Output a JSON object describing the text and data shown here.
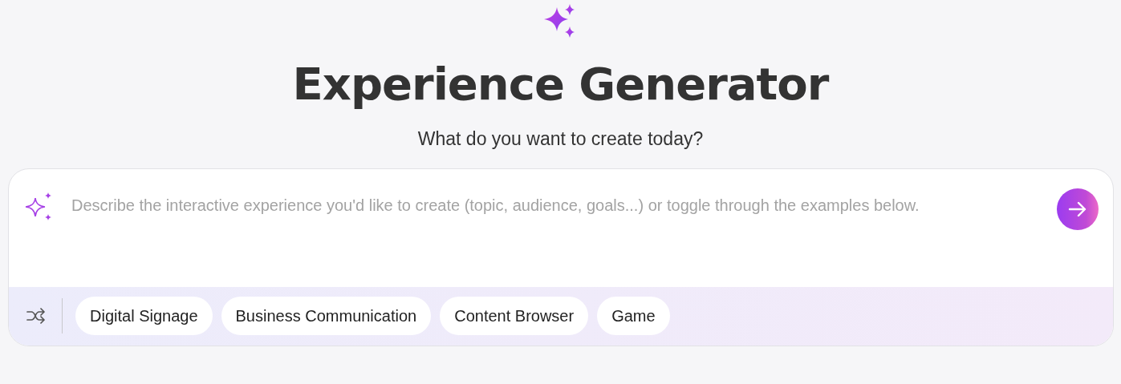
{
  "header": {
    "title": "Experience Generator",
    "subtitle": "What do you want to create today?"
  },
  "prompt": {
    "placeholder": "Describe the interactive experience you'd like to create (topic, audience, goals...) or toggle through the examples below."
  },
  "examples": [
    {
      "label": "Digital Signage"
    },
    {
      "label": "Business Communication"
    },
    {
      "label": "Content Browser"
    },
    {
      "label": "Game"
    }
  ]
}
